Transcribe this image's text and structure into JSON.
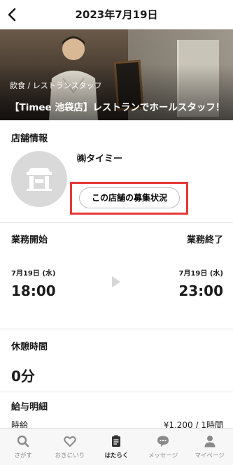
{
  "header": {
    "title": "2023年7月19日"
  },
  "hero": {
    "category": "飲食 / レストランスタッフ",
    "job_title": "【Timee 池袋店】レストランでホールスタッフ！"
  },
  "store": {
    "section_title": "店舗情報",
    "name": "㈱タイミー",
    "status_button": "この店舗の募集状況"
  },
  "work": {
    "start_label": "業務開始",
    "end_label": "業務終了",
    "start_date": "7月19日 (水)",
    "end_date": "7月19日 (水)",
    "start_time": "18:00",
    "end_time": "23:00"
  },
  "break": {
    "label": "休憩時間",
    "value": "0分"
  },
  "pay": {
    "label": "給与明細",
    "row_label": "時給",
    "row_value": "¥1,200 / 1時間"
  },
  "tabbar": {
    "items": [
      {
        "label": "さがす",
        "icon": "search-icon"
      },
      {
        "label": "おきにいり",
        "icon": "heart-icon"
      },
      {
        "label": "はたらく",
        "icon": "clipboard-icon",
        "active": true
      },
      {
        "label": "メッセージ",
        "icon": "chat-icon"
      },
      {
        "label": "マイページ",
        "icon": "person-icon"
      }
    ]
  },
  "colors": {
    "highlight": "#e53935",
    "tab_inactive": "#8a8a8a"
  }
}
